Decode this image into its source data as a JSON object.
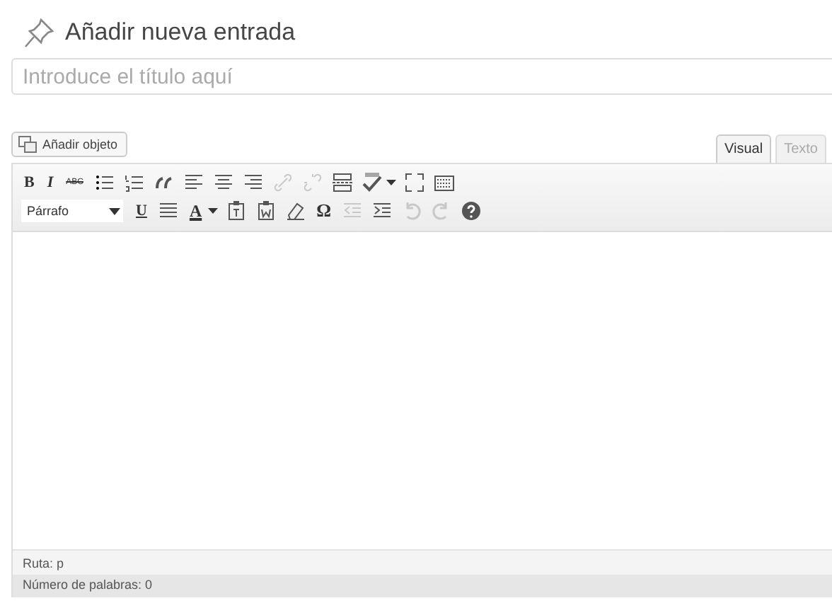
{
  "page": {
    "title": "Añadir nueva entrada"
  },
  "title_field": {
    "placeholder": "Introduce el título aquí"
  },
  "add_media_button": {
    "label": "Añadir objeto"
  },
  "editor_tabs": [
    {
      "label": "Visual",
      "selected": true
    },
    {
      "label": "Texto",
      "selected": false
    }
  ],
  "toolbar_rows": [
    [
      {
        "kind": "bold",
        "label": "B",
        "disabled": false
      },
      {
        "kind": "italic",
        "label": "I",
        "disabled": false
      },
      {
        "kind": "strike",
        "label": "ABC",
        "disabled": false
      },
      {
        "kind": "bullets",
        "disabled": false
      },
      {
        "kind": "numbers",
        "disabled": false
      },
      {
        "kind": "quote",
        "disabled": false
      },
      {
        "kind": "align-left",
        "disabled": false
      },
      {
        "kind": "align-center",
        "disabled": false
      },
      {
        "kind": "align-right",
        "disabled": false
      },
      {
        "kind": "link",
        "disabled": true
      },
      {
        "kind": "unlink",
        "disabled": true
      },
      {
        "kind": "more",
        "disabled": false
      },
      {
        "kind": "spell",
        "disabled": false
      },
      {
        "kind": "fullscreen",
        "disabled": false
      },
      {
        "kind": "keyboard",
        "disabled": false
      }
    ],
    [
      {
        "kind": "select",
        "label": "Párrafo",
        "disabled": false
      },
      {
        "kind": "underline",
        "label": "U",
        "disabled": false
      },
      {
        "kind": "justify",
        "disabled": false
      },
      {
        "kind": "color",
        "label": "A",
        "disabled": false
      },
      {
        "kind": "paste-text",
        "disabled": false
      },
      {
        "kind": "paste-word",
        "disabled": false
      },
      {
        "kind": "eraser",
        "disabled": false
      },
      {
        "kind": "omega",
        "label": "Ω",
        "disabled": false
      },
      {
        "kind": "outdent",
        "disabled": true
      },
      {
        "kind": "indent",
        "disabled": false
      },
      {
        "kind": "undo",
        "disabled": true
      },
      {
        "kind": "redo",
        "disabled": true
      },
      {
        "kind": "help",
        "disabled": false
      }
    ]
  ],
  "status_bar": {
    "path": "Ruta: p",
    "word_count": "Número de palabras: 0"
  }
}
